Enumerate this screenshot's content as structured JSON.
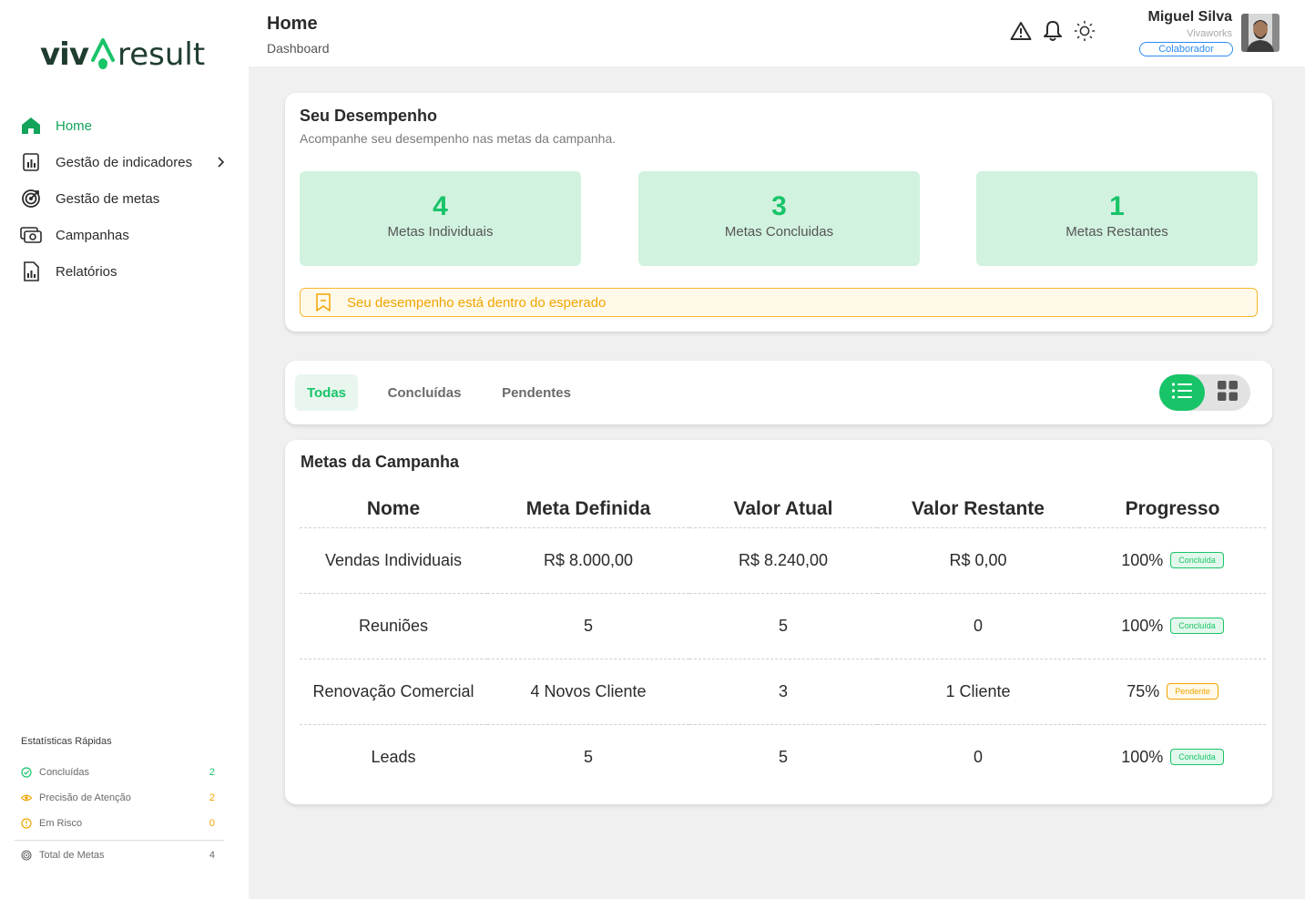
{
  "brand": {
    "logo_left": "viv",
    "logo_right": "result"
  },
  "sidebar": {
    "items": [
      {
        "label": "Home",
        "icon": "home-icon",
        "active": true
      },
      {
        "label": "Gestão de indicadores",
        "icon": "chart-icon",
        "has_submenu": true
      },
      {
        "label": "Gestão de metas",
        "icon": "target-icon"
      },
      {
        "label": "Campanhas",
        "icon": "camera-money-icon"
      },
      {
        "label": "Relatórios",
        "icon": "report-icon"
      }
    ]
  },
  "quick_stats": {
    "title": "Estatísticas Rápidas",
    "rows": [
      {
        "label": "Concluídas",
        "value": "2",
        "color": "#18c468"
      },
      {
        "label": "Precisão de Atenção",
        "value": "2",
        "color": "#f0a500"
      },
      {
        "label": "Em Risco",
        "value": "0",
        "color": "#f0a500"
      }
    ],
    "total": {
      "label": "Total de Metas",
      "value": "4"
    }
  },
  "header": {
    "title": "Home",
    "subtitle": "Dashboard",
    "icons": [
      "warning-icon",
      "bell-icon",
      "sun-icon"
    ]
  },
  "user": {
    "name": "Miguel Silva",
    "company": "Vivaworks",
    "role": "Colaborador"
  },
  "performance": {
    "title": "Seu Desempenho",
    "subtitle": "Acompanhe seu desempenho nas metas da campanha.",
    "stats": [
      {
        "value": "4",
        "label": "Metas Individuais"
      },
      {
        "value": "3",
        "label": "Metas Concluidas"
      },
      {
        "value": "1",
        "label": "Metas Restantes"
      }
    ],
    "alert": "Seu desempenho está dentro do esperado"
  },
  "tabs": {
    "items": [
      {
        "label": "Todas",
        "active": true
      },
      {
        "label": "Concluídas"
      },
      {
        "label": "Pendentes"
      }
    ],
    "view_modes": [
      "list-view-icon",
      "grid-view-icon"
    ]
  },
  "goals": {
    "title": "Metas da Campanha",
    "columns": [
      "Nome",
      "Meta Definida",
      "Valor Atual",
      "Valor Restante",
      "Progresso"
    ],
    "rows": [
      {
        "name": "Vendas Individuais",
        "target": "R$ 8.000,00",
        "current": "R$ 8.240,00",
        "remaining": "R$ 0,00",
        "progress": "100%",
        "status": "Concluída",
        "status_type": "done"
      },
      {
        "name": "Reuniões",
        "target": "5",
        "current": "5",
        "remaining": "0",
        "progress": "100%",
        "status": "Concluída",
        "status_type": "done"
      },
      {
        "name": "Renovação Comercial",
        "target": "4 Novos Cliente",
        "current": "3",
        "remaining": "1 Cliente",
        "progress": "75%",
        "status": "Pendente",
        "status_type": "pending"
      },
      {
        "name": "Leads",
        "target": "5",
        "current": "5",
        "remaining": "0",
        "progress": "100%",
        "status": "Concluída",
        "status_type": "done"
      }
    ]
  },
  "colors": {
    "accent": "#18c468",
    "brand_dark": "#1f3d2f",
    "warning": "#f0a500",
    "info": "#2a8bf2",
    "stat_bg": "#d1f2df"
  }
}
